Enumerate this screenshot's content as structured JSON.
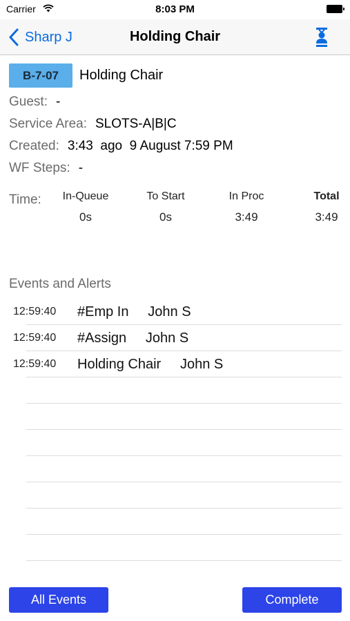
{
  "status_bar": {
    "carrier": "Carrier",
    "time": "8:03 PM"
  },
  "nav": {
    "back_label": "Sharp J",
    "title": "Holding Chair",
    "action_icon": "person-queue-icon"
  },
  "ticket": {
    "code": "B-7-07",
    "name": "Holding Chair"
  },
  "info": {
    "guest": {
      "label": "Guest:",
      "value": "-"
    },
    "service_area": {
      "label": "Service Area:",
      "value": "SLOTS-A|B|C"
    },
    "created": {
      "label": "Created:",
      "value": "3:43  ago  9 August 7:59 PM"
    },
    "wf_steps": {
      "label": "WF Steps:",
      "value": "-"
    }
  },
  "time": {
    "label": "Time:",
    "columns": [
      {
        "head": "In-Queue",
        "value": "0s"
      },
      {
        "head": "To Start",
        "value": "0s"
      },
      {
        "head": "In Proc",
        "value": "3:49"
      },
      {
        "head": "Total",
        "value": "3:49"
      }
    ]
  },
  "events": {
    "header": "Events and Alerts",
    "rows": [
      {
        "time": "12:59:40",
        "text": "#Emp In     John S"
      },
      {
        "time": "12:59:40",
        "text": "#Assign     John S"
      },
      {
        "time": "12:59:40",
        "text": "Holding Chair     John S"
      },
      {
        "time": "",
        "text": ""
      },
      {
        "time": "",
        "text": ""
      },
      {
        "time": "",
        "text": ""
      },
      {
        "time": "",
        "text": ""
      },
      {
        "time": "",
        "text": ""
      },
      {
        "time": "",
        "text": ""
      },
      {
        "time": "",
        "text": ""
      }
    ]
  },
  "buttons": {
    "all_events": "All Events",
    "complete": "Complete"
  },
  "colors": {
    "accent": "#0a6be0",
    "button": "#2c44e8",
    "badge": "#5aaeea"
  }
}
